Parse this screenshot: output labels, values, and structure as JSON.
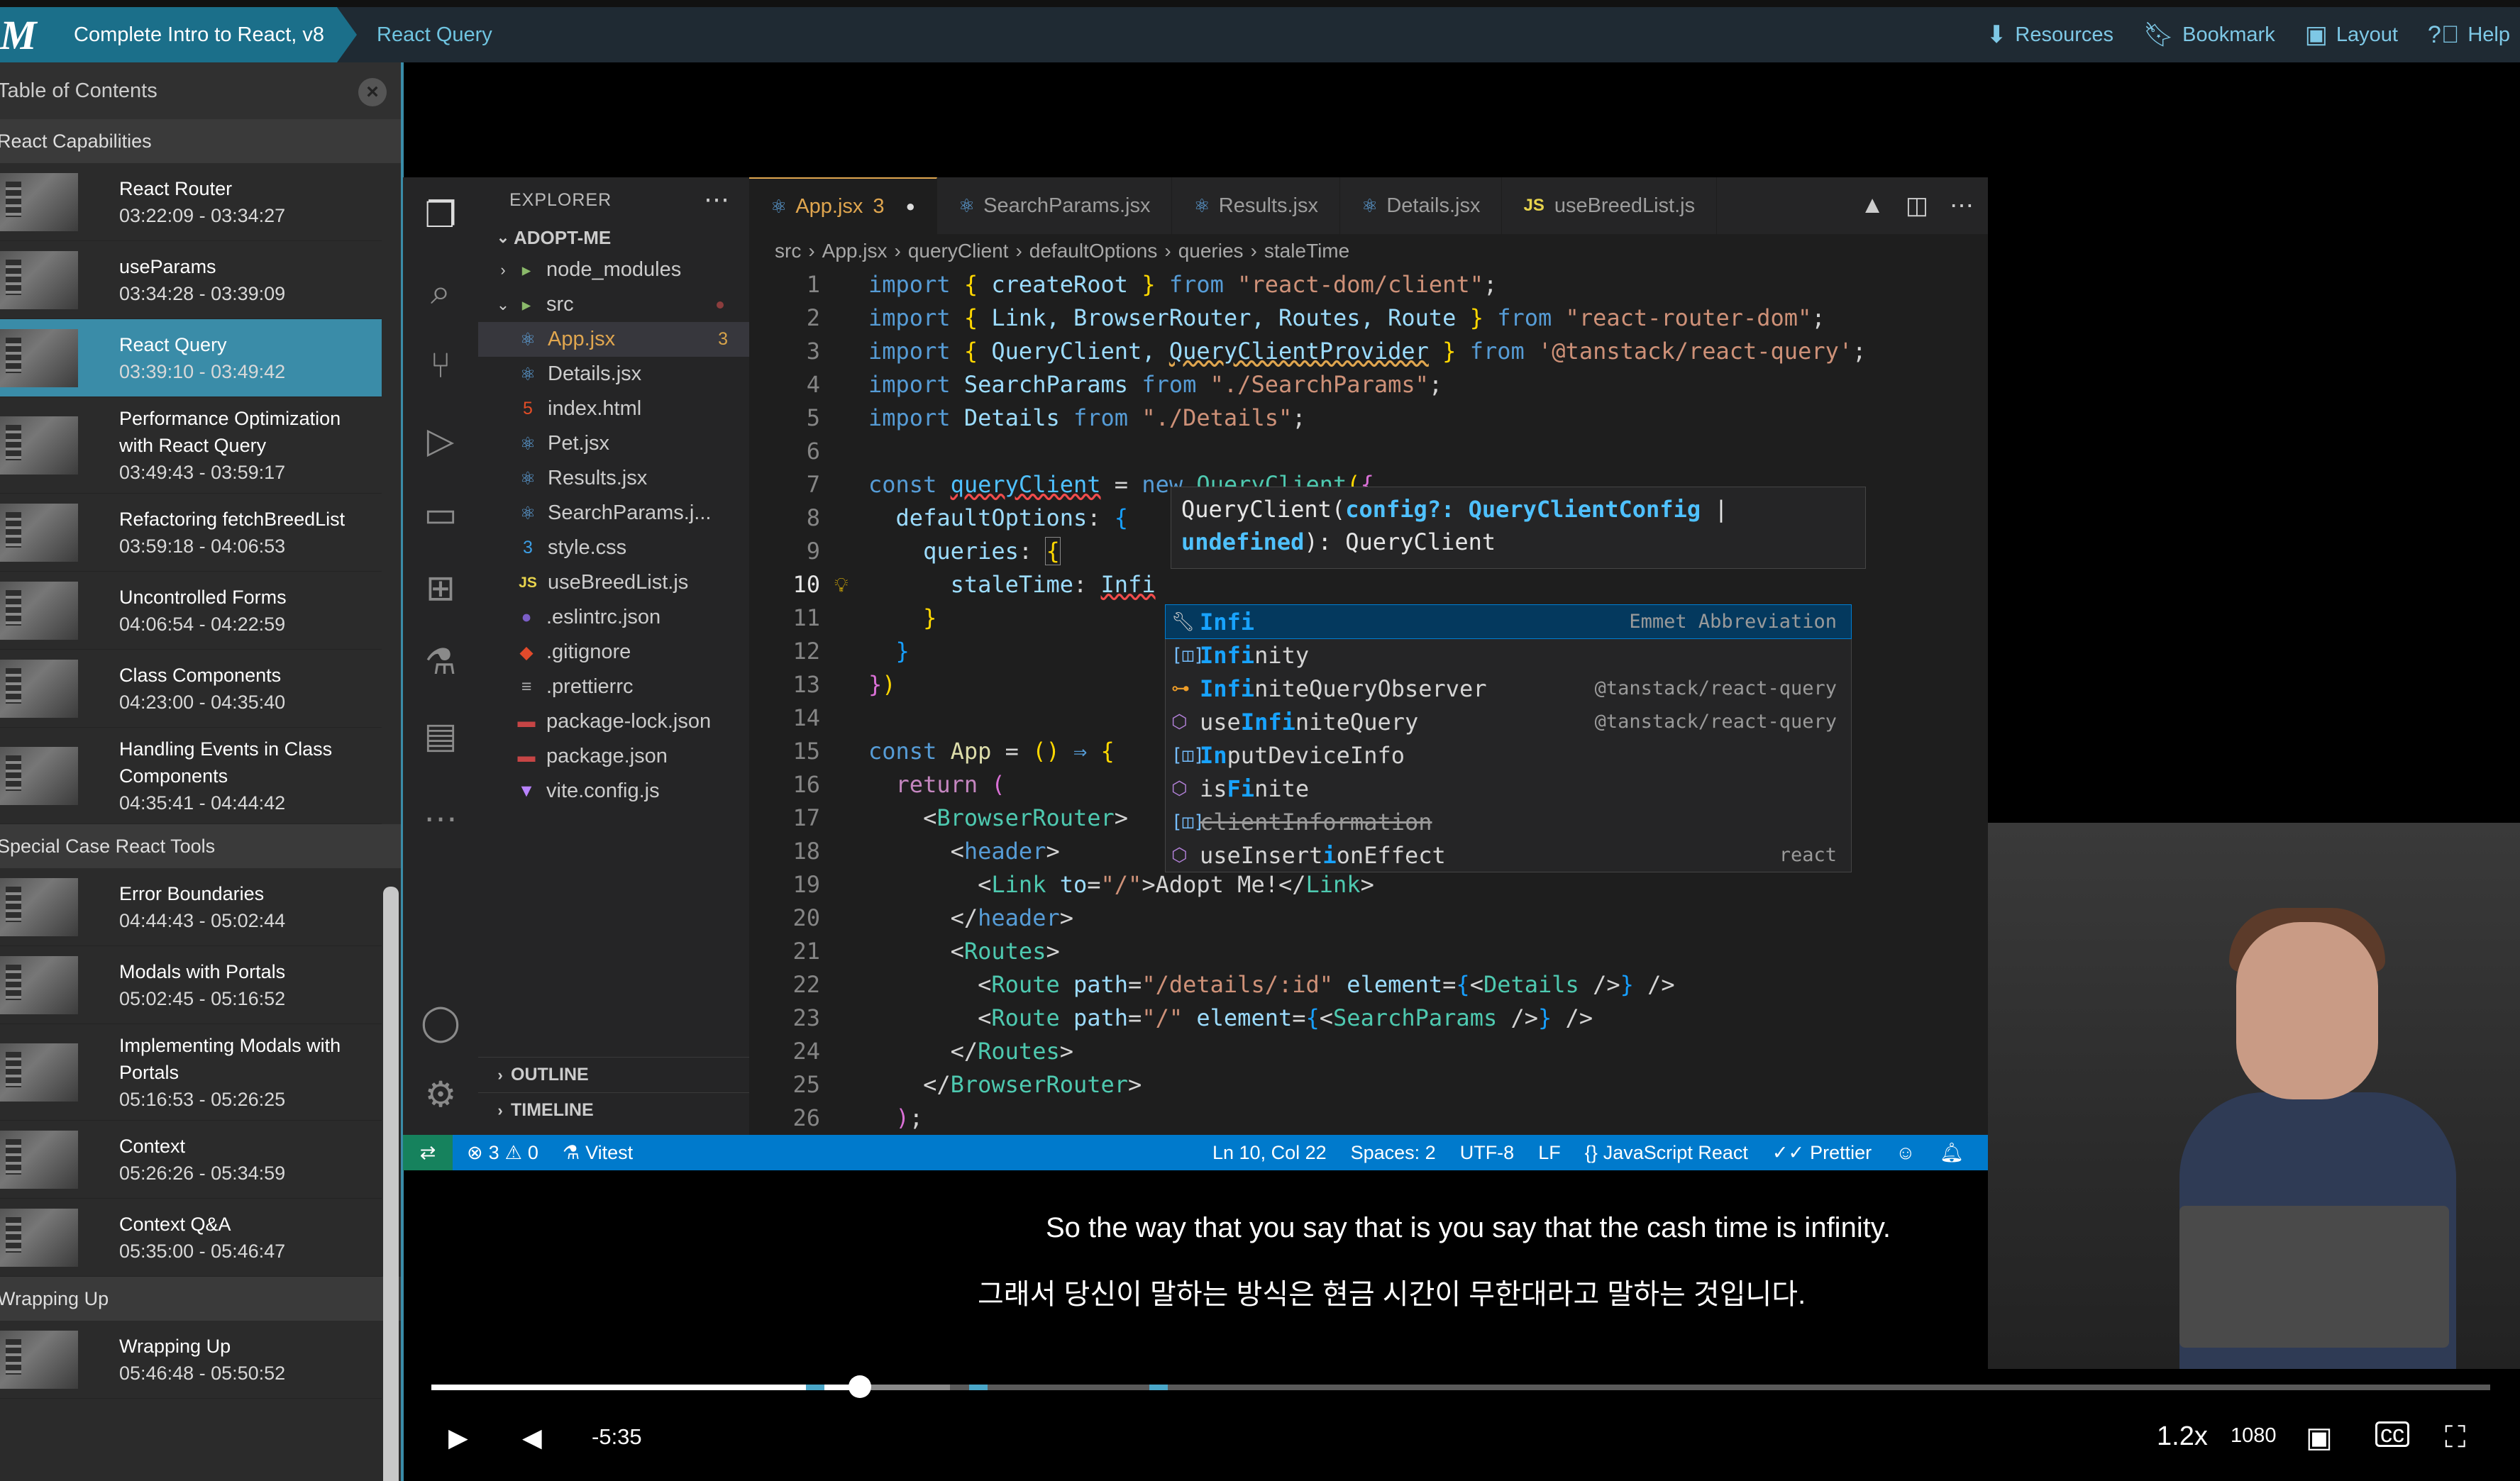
{
  "header": {
    "logo": "M",
    "course": "Complete Intro to React, v8",
    "lesson": "React Query",
    "links": [
      {
        "icon": "download-icon",
        "label": "Resources"
      },
      {
        "icon": "bookmark-icon",
        "label": "Bookmark"
      },
      {
        "icon": "layout-icon",
        "label": "Layout"
      },
      {
        "icon": "help-icon",
        "label": "Help"
      }
    ]
  },
  "toc": {
    "title": "Table of Contents",
    "sections": [
      {
        "title": "React Capabilities",
        "items": [
          {
            "title": "React Router",
            "time": "03:22:09 - 03:34:27"
          },
          {
            "title": "useParams",
            "time": "03:34:28 - 03:39:09"
          },
          {
            "title": "React Query",
            "time": "03:39:10 - 03:49:42",
            "active": true
          },
          {
            "title": "Performance Optimization with React Query",
            "time": "03:49:43 - 03:59:17"
          },
          {
            "title": "Refactoring fetchBreedList",
            "time": "03:59:18 - 04:06:53"
          },
          {
            "title": "Uncontrolled Forms",
            "time": "04:06:54 - 04:22:59"
          },
          {
            "title": "Class Components",
            "time": "04:23:00 - 04:35:40"
          },
          {
            "title": "Handling Events in Class Components",
            "time": "04:35:41 - 04:44:42"
          }
        ]
      },
      {
        "title": "Special Case React Tools",
        "items": [
          {
            "title": "Error Boundaries",
            "time": "04:44:43 - 05:02:44"
          },
          {
            "title": "Modals with Portals",
            "time": "05:02:45 - 05:16:52"
          },
          {
            "title": "Implementing Modals with Portals",
            "time": "05:16:53 - 05:26:25"
          },
          {
            "title": "Context",
            "time": "05:26:26 - 05:34:59"
          },
          {
            "title": "Context Q&A",
            "time": "05:35:00 - 05:46:47"
          }
        ]
      },
      {
        "title": "Wrapping Up",
        "items": [
          {
            "title": "Wrapping Up",
            "time": "05:46:48 - 05:50:52"
          }
        ]
      }
    ]
  },
  "vscode": {
    "explorer_title": "EXPLORER",
    "project": "ADOPT-ME",
    "files": [
      {
        "name": "node_modules",
        "kind": "folder",
        "depth": 1,
        "open": false
      },
      {
        "name": "src",
        "kind": "folder",
        "depth": 1,
        "open": true
      },
      {
        "name": "App.jsx",
        "kind": "react",
        "depth": 2,
        "badge": "3",
        "selected": true
      },
      {
        "name": "Details.jsx",
        "kind": "react",
        "depth": 2
      },
      {
        "name": "index.html",
        "kind": "html",
        "depth": 2
      },
      {
        "name": "Pet.jsx",
        "kind": "react",
        "depth": 2
      },
      {
        "name": "Results.jsx",
        "kind": "react",
        "depth": 2
      },
      {
        "name": "SearchParams.j...",
        "kind": "react",
        "depth": 2
      },
      {
        "name": "style.css",
        "kind": "css",
        "depth": 2
      },
      {
        "name": "useBreedList.js",
        "kind": "js",
        "depth": 2
      },
      {
        "name": ".eslintrc.json",
        "kind": "eslint",
        "depth": 1
      },
      {
        "name": ".gitignore",
        "kind": "git",
        "depth": 1
      },
      {
        "name": ".prettierrc",
        "kind": "prettier",
        "depth": 1
      },
      {
        "name": "package-lock.json",
        "kind": "npm",
        "depth": 1
      },
      {
        "name": "package.json",
        "kind": "npm",
        "depth": 1
      },
      {
        "name": "vite.config.js",
        "kind": "vite",
        "depth": 1
      }
    ],
    "outline": "OUTLINE",
    "timeline": "TIMELINE",
    "tabs": [
      {
        "label": "App.jsx",
        "badge": "3",
        "active": true
      },
      {
        "label": "SearchParams.jsx"
      },
      {
        "label": "Results.jsx"
      },
      {
        "label": "Details.jsx"
      },
      {
        "label": "useBreedList.js",
        "js": true
      }
    ],
    "breadcrumb": [
      "src",
      "App.jsx",
      "queryClient",
      "defaultOptions",
      "queries",
      "staleTime"
    ],
    "current_line": 10,
    "hover_sig": [
      "QueryClient(",
      "config?: ",
      "QueryClientConfig",
      " |",
      "undefined",
      "): QueryClient"
    ],
    "suggestions": [
      {
        "pre": "",
        "hl": "Infi",
        "post": "",
        "right": "Emmet Abbreviation",
        "icon": "wrench-icon",
        "selected": true
      },
      {
        "pre": "",
        "hl": "Infi",
        "post": "nity",
        "right": "",
        "icon": "variable-icon"
      },
      {
        "pre": "",
        "hl": "Infi",
        "post": "niteQueryObserver",
        "right": "@tanstack/react-query",
        "icon": "class-icon"
      },
      {
        "pre": "use",
        "hl": "Infi",
        "post": "niteQuery",
        "right": "@tanstack/react-query",
        "icon": "function-icon"
      },
      {
        "pre": "",
        "hl": "In",
        "post": "putDeviceInfo",
        "right": "",
        "icon": "variable-icon"
      },
      {
        "pre": "is",
        "hl": "Fi",
        "post": "nite",
        "right": "",
        "icon": "function-icon"
      },
      {
        "pre": "",
        "hl": "",
        "post": "clientInformation",
        "right": "",
        "icon": "variable-icon",
        "strike": true
      },
      {
        "pre": "useInsert",
        "hl": "i",
        "post": "onEffect",
        "right": "react",
        "icon": "function-icon"
      }
    ],
    "status": {
      "errors": "3",
      "warnings": "0",
      "test": "Vitest",
      "position": "Ln 10, Col 22",
      "spaces": "Spaces: 2",
      "encoding": "UTF-8",
      "eol": "LF",
      "language": "JavaScript React",
      "formatter": "Prettier"
    }
  },
  "captions": {
    "en": "So the way that you say that is you say that the cash time is infinity.",
    "ko": "그래서 당신이 말하는 방식은 현금 시간이 무한대라고 말하는 것입니다."
  },
  "player": {
    "remaining": "-5:35",
    "speed": "1.2x",
    "quality": "1080",
    "progress": 0.208,
    "buffered": 0.252
  }
}
